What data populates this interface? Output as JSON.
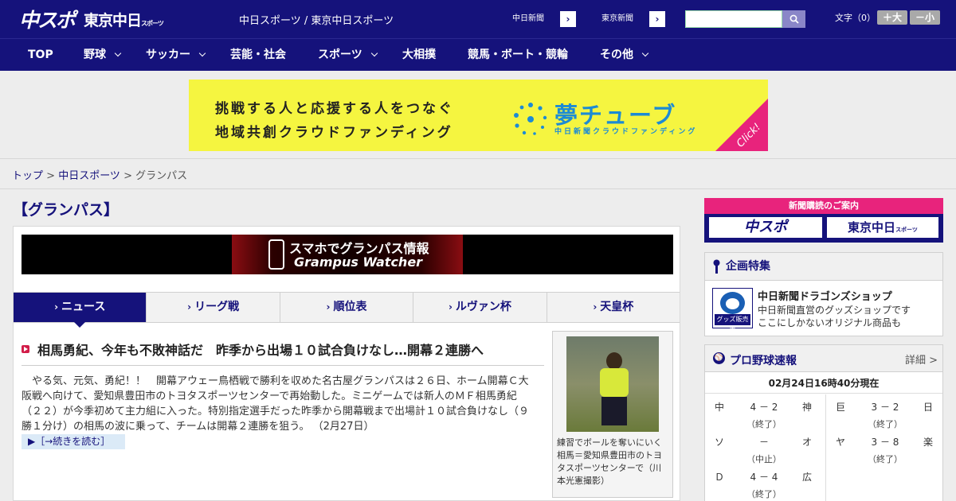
{
  "header": {
    "logo_main": "中スポ",
    "logo_sub": "東京中日",
    "logo_sub_small": "スポーツ",
    "site_title": "中日スポーツ / 東京中日スポーツ",
    "paper_links": [
      {
        "label": "中日新聞",
        "arrow": "›"
      },
      {
        "label": "東京新聞",
        "arrow": "›"
      }
    ],
    "search_placeholder": "",
    "font_size_label": "文字（0）",
    "font_larger": "＋大",
    "font_smaller": "－小"
  },
  "nav": {
    "items": [
      {
        "label": "TOP"
      },
      {
        "label": "野球"
      },
      {
        "label": "サッカー"
      },
      {
        "label": "芸能・社会"
      },
      {
        "label": "スポーツ"
      },
      {
        "label": "大相撲"
      },
      {
        "label": "競馬・ボート・競輪"
      },
      {
        "label": "その他"
      }
    ]
  },
  "banner": {
    "line1": "挑戦する人と応援する人をつなぐ",
    "line2": "地域共創クラウドファンディング",
    "brand": "夢チューブ",
    "brand_sub": "中日新聞クラウドファンディング",
    "click": "Click!"
  },
  "breadcrumb": {
    "home": "トップ",
    "sep1": " > ",
    "section": "中日スポーツ",
    "sep2": " > ",
    "current": "グランパス"
  },
  "page_title": "【グランパス】",
  "promo": {
    "line1": "スマホでグランパス情報",
    "line2": "Grampus Watcher"
  },
  "tabs": [
    {
      "label": "ニュース",
      "chev": "›",
      "active": true
    },
    {
      "label": "リーグ戦",
      "chev": "›"
    },
    {
      "label": "順位表",
      "chev": "›"
    },
    {
      "label": "ルヴァン杯",
      "chev": "›"
    },
    {
      "label": "天皇杯",
      "chev": "›"
    }
  ],
  "article": {
    "headline": "相馬勇紀、今年も不敗神話だ　昨季から出場１０試合負けなし…開幕２連勝へ",
    "body": "　やる気、元気、勇紀！！　開幕アウェー鳥栖戦で勝利を収めた名古屋グランパスは２６日、ホーム開幕Ｃ大阪戦へ向けて、愛知県豊田市のトヨタスポーツセンターで再始動した。ミニゲームでは新人のＭＦ相馬勇紀（２２）が今季初めて主力組に入った。特別指定選手だった昨季から開幕戦まで出場計１０試合負けなし（９勝１分け）の相馬の波に乗って、チームは開幕２連勝を狙う。 （2月27日）",
    "readmore": "▶［→続きを読む］",
    "photo_caption": "練習でボールを奪いにいく相馬＝愛知県豊田市のトヨタスポーツセンターで（川本光憲撮影）"
  },
  "sidebar": {
    "subscribe_head": "新聞購読のご案内",
    "subscribe_logo1": "中スポ",
    "subscribe_logo2": "東京中日",
    "subscribe_logo2_small": "スポーツ",
    "feature_head": "企画特集",
    "shop_tag": "グッズ販売中",
    "shop_title": "中日新聞ドラゴンズショップ",
    "shop_desc1": "中日新聞直営のグッズショップです",
    "shop_desc2": "ここにしかないオリジナル商品も",
    "score_title": "プロ野球速報",
    "score_more": "詳細 >",
    "score_time": "02月24日16時40分現在",
    "games_left": [
      {
        "a": "中",
        "score": "4 － 2",
        "b": "神",
        "status": "（終了）"
      },
      {
        "a": "ソ",
        "score": "－",
        "b": "オ",
        "status": "（中止）"
      },
      {
        "a": "Ｄ",
        "score": "4 － 4",
        "b": "広",
        "status": "（終了）"
      }
    ],
    "games_right": [
      {
        "a": "巨",
        "score": "3 － 2",
        "b": "日",
        "status": "（終了）"
      },
      {
        "a": "ヤ",
        "score": "3 － 8",
        "b": "楽",
        "status": "（終了）"
      }
    ]
  },
  "colors": {
    "brand_navy": "#15127b",
    "accent_pink": "#e8237c",
    "banner_yellow": "#f5f540"
  }
}
